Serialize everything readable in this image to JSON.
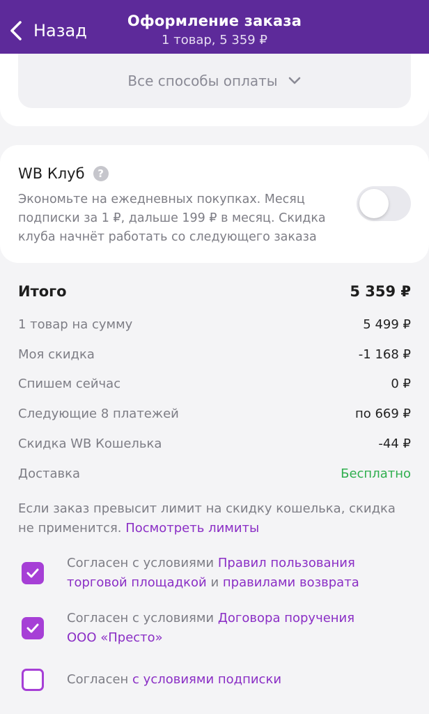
{
  "header": {
    "back_label": "Назад",
    "title": "Оформление заказа",
    "subtitle": "1 товар, 5 359 ₽",
    "bg_color": "#5d2a9a"
  },
  "payment": {
    "all_methods_label": "Все способы оплаты"
  },
  "club": {
    "title": "WB Клуб",
    "help_icon": "?",
    "description": "Экономьте на ежедневных покупках. Месяц подписки за 1 ₽, дальше 199 ₽ в месяц. Скидка клуба начнёт работать со следующего заказа",
    "toggle_on": false
  },
  "summary": {
    "total_label": "Итого",
    "total_value": "5 359 ₽",
    "rows": [
      {
        "label": "1 товар на сумму",
        "value": "5 499 ₽"
      },
      {
        "label": "Моя скидка",
        "value": "-1 168 ₽"
      },
      {
        "label": "Спишем сейчас",
        "value": "0 ₽"
      },
      {
        "label": "Следующие 8 платежей",
        "value": "по 669 ₽"
      },
      {
        "label": "Скидка WB Кошелька",
        "value": "-44 ₽"
      },
      {
        "label": "Доставка",
        "value": "Бесплатно"
      }
    ],
    "free_color": "#2fae4e"
  },
  "note": {
    "text": "Если заказ превысит лимит на скидку кошелька, скидка не применится. ",
    "link": "Посмотреть лимиты"
  },
  "agreements": [
    {
      "checked": true,
      "prefix": "Согласен с условиями ",
      "link1": "Правил пользования торговой площадкой",
      "middle": " и ",
      "link2": "правилами возврата"
    },
    {
      "checked": true,
      "prefix": "Согласен с условиями ",
      "link1": "Договора поручения ООО «Престо»"
    },
    {
      "checked": false,
      "prefix": "Согласен ",
      "link1": "с условиями подписки"
    }
  ],
  "accent_color": "#a63fd6"
}
